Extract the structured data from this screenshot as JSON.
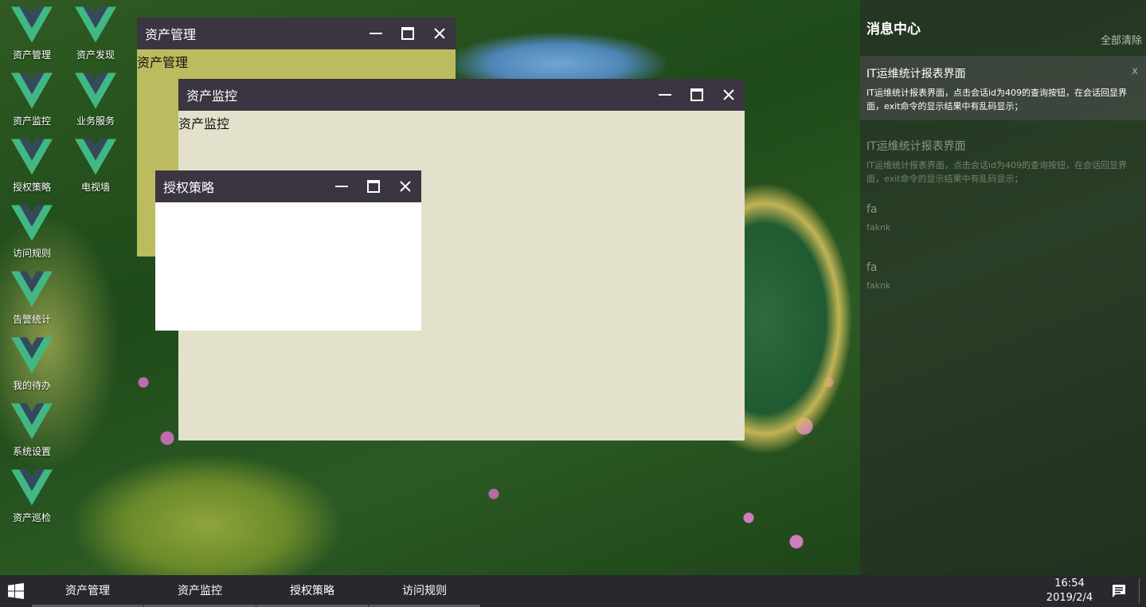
{
  "desktop": {
    "icon_name": "vue-logo-icon",
    "icon_colors": {
      "outer": "#41b883",
      "inner": "#35495e"
    },
    "icons": [
      {
        "label": "资产管理"
      },
      {
        "label": "资产发现"
      },
      {
        "label": "资产监控"
      },
      {
        "label": "业务服务"
      },
      {
        "label": "授权策略"
      },
      {
        "label": "电视墙"
      },
      {
        "label": "访问规则"
      },
      {
        "label": "告警统计"
      },
      {
        "label": "我的待办"
      },
      {
        "label": "系统设置"
      },
      {
        "label": "资产巡检"
      }
    ]
  },
  "windows": {
    "asset_mgmt": {
      "title": "资产管理",
      "content": "资产管理",
      "bg": "#bcbb5f"
    },
    "asset_monitor": {
      "title": "资产监控",
      "content": "资产监控",
      "bg": "#e3e0cb"
    },
    "auth_policy": {
      "title": "授权策略",
      "content": "",
      "bg": "#ffffff"
    },
    "controls": {
      "minimize": "minimize-icon",
      "maximize": "maximize-icon",
      "close": "close-icon"
    },
    "titlebar_color": "#3a3541"
  },
  "message_center": {
    "title": "消息中心",
    "clear_all": "全部清除",
    "close_label": "x",
    "messages": [
      {
        "title": "IT运维统计报表界面",
        "body": "IT运维统计报表界面，点击会话id为409的查询按钮，在会话回显界面，exit命令的显示结果中有乱码显示；"
      },
      {
        "title": "IT运维统计报表界面",
        "body": "IT运维统计报表界面，点击会话id为409的查询按钮，在会话回显界面，exit命令的显示结果中有乱码显示；"
      },
      {
        "title": "fa",
        "body": "faknk"
      },
      {
        "title": "fa",
        "body": "faknk"
      }
    ]
  },
  "taskbar": {
    "start_icon": "windows-logo-icon",
    "items": [
      {
        "label": "资产管理"
      },
      {
        "label": "资产监控"
      },
      {
        "label": "授权策略"
      },
      {
        "label": "访问规则"
      }
    ],
    "time": "16:54",
    "date": "2019/2/4",
    "notification_icon": "message-icon"
  }
}
